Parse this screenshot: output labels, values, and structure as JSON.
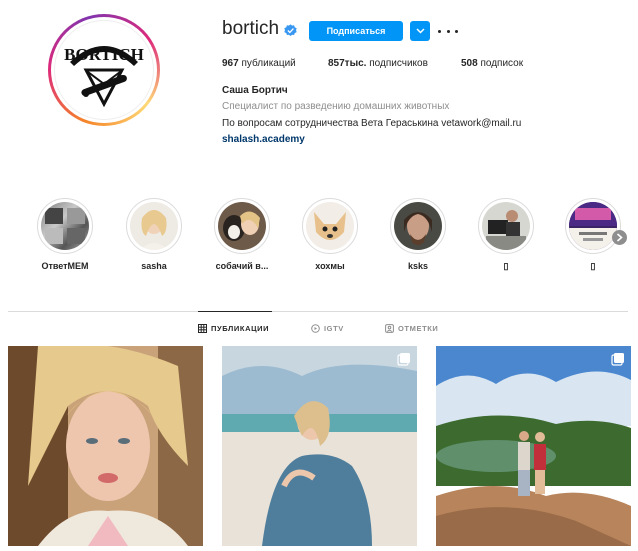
{
  "profile": {
    "username": "bortich",
    "avatar_logo_text": "BORTICH",
    "follow_label": "Подписаться",
    "stats": {
      "posts_count": "967",
      "posts_label": "публикаций",
      "followers_count": "857тыс.",
      "followers_label": "подписчиков",
      "following_count": "508",
      "following_label": "подписок"
    },
    "bio": {
      "name": "Саша Бортич",
      "category": "Специалист по разведению домашних животных",
      "text": "По вопросам сотрудничества Вета Гераськина vetawork@mail.ru",
      "link": "shalash.academy"
    }
  },
  "highlights": [
    {
      "label": "ОтветMEM"
    },
    {
      "label": "sasha"
    },
    {
      "label": "собачий в..."
    },
    {
      "label": "хохмы"
    },
    {
      "label": "ksks"
    },
    {
      "label": "▯"
    },
    {
      "label": "▯"
    }
  ],
  "tabs": [
    {
      "label": "ПУБЛИКАЦИИ",
      "icon": "grid-icon",
      "active": true
    },
    {
      "label": "IGTV",
      "icon": "igtv-icon",
      "active": false
    },
    {
      "label": "ОТМЕТКИ",
      "icon": "tagged-icon",
      "active": false
    }
  ],
  "colors": {
    "accent": "#0095f6",
    "text": "#262626",
    "muted": "#8e8e8e",
    "link": "#00376b",
    "border": "#dbdbdb"
  }
}
